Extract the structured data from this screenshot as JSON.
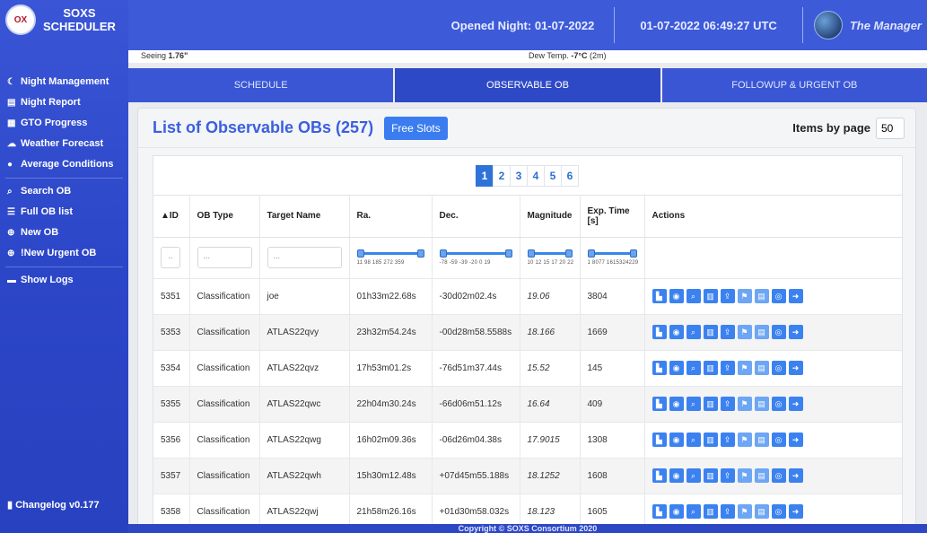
{
  "app": {
    "name_line1": "SOXS",
    "name_line2": "SCHEDULER",
    "logo_text": "OX"
  },
  "sidebar": {
    "items": [
      {
        "icon": "moon-icon",
        "glyph": "☾",
        "label": "Night Management"
      },
      {
        "icon": "document-icon",
        "glyph": "▤",
        "label": "Night Report"
      },
      {
        "icon": "calendar-icon",
        "glyph": "▦",
        "label": "GTO Progress"
      },
      {
        "icon": "weather-icon",
        "glyph": "☁",
        "label": "Weather Forecast"
      },
      {
        "icon": "info-icon",
        "glyph": "●",
        "label": "Average Conditions"
      },
      {
        "icon": "search-icon",
        "glyph": "⌕",
        "label": "Search OB"
      },
      {
        "icon": "list-icon",
        "glyph": "☰",
        "label": "Full OB list"
      },
      {
        "icon": "plus-icon",
        "glyph": "⊕",
        "label": "New OB"
      },
      {
        "icon": "plus-icon",
        "glyph": "⊕",
        "label": "!New Urgent OB"
      },
      {
        "icon": "log-icon",
        "glyph": "▬",
        "label": "Show Logs"
      }
    ],
    "changelog": "Changelog v0.177"
  },
  "header": {
    "opened_night": "Opened Night: 01-07-2022",
    "datetime": "01-07-2022 06:49:27 UTC",
    "user": "The Manager"
  },
  "conditions": {
    "seeing_label": "Seeing",
    "seeing_value": "1.76\"",
    "dew_label": "Dew Temp.",
    "dew_value": "-7°C",
    "dew_unit": "(2m)"
  },
  "tabs": [
    {
      "label": "SCHEDULE"
    },
    {
      "label": "OBSERVABLE OB"
    },
    {
      "label": "FOLLOWUP & URGENT OB"
    }
  ],
  "list": {
    "title": "List of Observable OBs (257)",
    "free_slots": "Free Slots",
    "items_by_page_label": "Items by page",
    "items_by_page_value": "50"
  },
  "pagination": [
    "1",
    "2",
    "3",
    "4",
    "5",
    "6"
  ],
  "table": {
    "headers": [
      "▲ID",
      "OB Type",
      "Target Name",
      "Ra.",
      "Dec.",
      "Magnitude",
      "Exp. Time [s]",
      "Actions"
    ],
    "filters": {
      "id": "..",
      "type": "...",
      "name": "..."
    },
    "sliders": {
      "ra": "11   98   185   272   359",
      "dec": "-78   -59   -39   -20   0   19",
      "mag": "10 12 15 17 20 22",
      "exp": "1    8077 1615324229"
    },
    "rows": [
      {
        "id": "5351",
        "type": "Classification",
        "name": "joe",
        "ra": "01h33m22.68s",
        "dec": "-30d02m02.4s",
        "mag": "19.06",
        "exp": "3804"
      },
      {
        "id": "5353",
        "type": "Classification",
        "name": "ATLAS22qvy",
        "ra": "23h32m54.24s",
        "dec": "-00d28m58.5588s",
        "mag": "18.166",
        "exp": "1669"
      },
      {
        "id": "5354",
        "type": "Classification",
        "name": "ATLAS22qvz",
        "ra": "17h53m01.2s",
        "dec": "-76d51m37.44s",
        "mag": "15.52",
        "exp": "145"
      },
      {
        "id": "5355",
        "type": "Classification",
        "name": "ATLAS22qwc",
        "ra": "22h04m30.24s",
        "dec": "-66d06m51.12s",
        "mag": "16.64",
        "exp": "409"
      },
      {
        "id": "5356",
        "type": "Classification",
        "name": "ATLAS22qwg",
        "ra": "16h02m09.36s",
        "dec": "-06d26m04.38s",
        "mag": "17.9015",
        "exp": "1308"
      },
      {
        "id": "5357",
        "type": "Classification",
        "name": "ATLAS22qwh",
        "ra": "15h30m12.48s",
        "dec": "+07d45m55.188s",
        "mag": "18.1252",
        "exp": "1608"
      },
      {
        "id": "5358",
        "type": "Classification",
        "name": "ATLAS22qwj",
        "ra": "21h58m26.16s",
        "dec": "+01d30m58.032s",
        "mag": "18.123",
        "exp": "1605"
      }
    ],
    "action_icons": [
      {
        "name": "chart-icon",
        "glyph": "▙"
      },
      {
        "name": "eye-icon",
        "glyph": "◉"
      },
      {
        "name": "zoom-icon",
        "glyph": "⌕"
      },
      {
        "name": "trash-icon",
        "glyph": "▥"
      },
      {
        "name": "upload-icon",
        "glyph": "⇪"
      },
      {
        "name": "flag-icon",
        "glyph": "⚑"
      },
      {
        "name": "file-icon",
        "glyph": "▤"
      },
      {
        "name": "view-icon",
        "glyph": "◎"
      },
      {
        "name": "login-icon",
        "glyph": "➜"
      }
    ]
  },
  "footer": "Copyright © SOXS Consortium 2020"
}
